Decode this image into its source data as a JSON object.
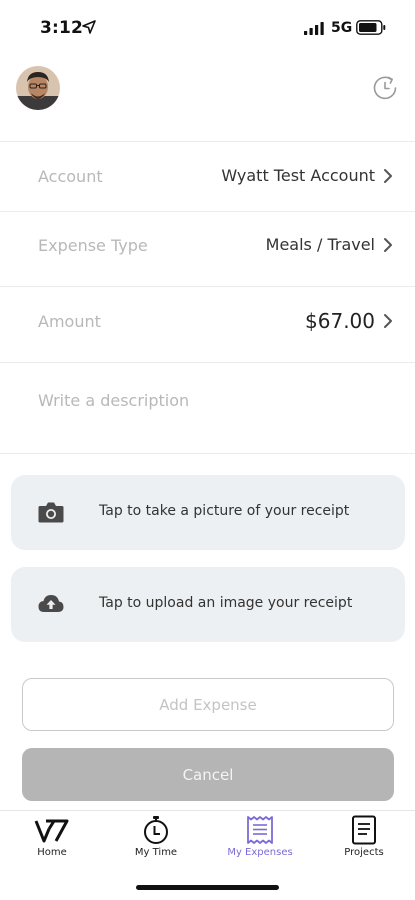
{
  "status_bar": {
    "time": "3:12",
    "network": "5G"
  },
  "form": {
    "account": {
      "label": "Account",
      "value": "Wyatt Test Account"
    },
    "expense_type": {
      "label": "Expense Type",
      "value": "Meals / Travel"
    },
    "amount": {
      "label": "Amount",
      "value": "$67.00"
    },
    "description": {
      "placeholder": "Write a description"
    }
  },
  "receipt": {
    "photo_label": "Tap to take a picture of your receipt",
    "upload_label": "Tap to upload an image your receipt"
  },
  "buttons": {
    "add": "Add Expense",
    "cancel": "Cancel"
  },
  "tabs": [
    {
      "label": "Home",
      "icon": "logo-icon"
    },
    {
      "label": "My Time",
      "icon": "stopwatch-icon"
    },
    {
      "label": "My Expenses",
      "icon": "receipt-icon",
      "active": true
    },
    {
      "label": "Projects",
      "icon": "document-icon"
    }
  ],
  "colors": {
    "accent": "#7d6bd6",
    "card_background": "#edf0f2",
    "cancel_button": "#b5b5b5",
    "muted_text": "#b8b8b8"
  }
}
